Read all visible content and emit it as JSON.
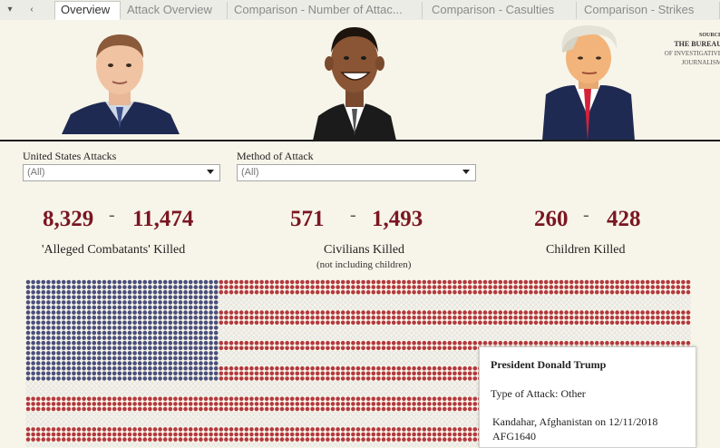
{
  "tabs": {
    "nav_prev": "▾",
    "nav_next": "‹",
    "items": [
      {
        "label": "Overview"
      },
      {
        "label": "Attack Overview"
      },
      {
        "label": "Comparison - Number of Attac..."
      },
      {
        "label": "Comparison - Casulties"
      },
      {
        "label": "Comparison - Strikes"
      }
    ]
  },
  "header": {
    "source_label": "SOURCE",
    "source_name": "THE BUREAU",
    "source_sub1": "OF INVESTIGATIVE",
    "source_sub2": "JOURNALISM"
  },
  "filters": [
    {
      "label": "United States Attacks",
      "value": "(All)"
    },
    {
      "label": "Method of Attack",
      "value": "(All)"
    }
  ],
  "stats": {
    "combatants": {
      "min": "8,329",
      "dash": "-",
      "max": "11,474",
      "label": "'Alleged Combatants' Killed"
    },
    "civilians": {
      "min": "571",
      "dash": "-",
      "max": "1,493",
      "label": "Civilians Killed",
      "sublabel": "(not including children)"
    },
    "children": {
      "min": "260",
      "dash": "-",
      "max": "428",
      "label": "Children Killed"
    }
  },
  "colors": {
    "blue": "#4a4f7c",
    "red": "#b3393f",
    "white_dot": "#f1f1ee",
    "accent_text": "#7a1622"
  },
  "tooltip": {
    "title": "President Donald Trump",
    "type": "Type of Attack: Other",
    "location": "Kandahar, Afghanistan on 12/11/2018",
    "id": "AFG1640"
  }
}
